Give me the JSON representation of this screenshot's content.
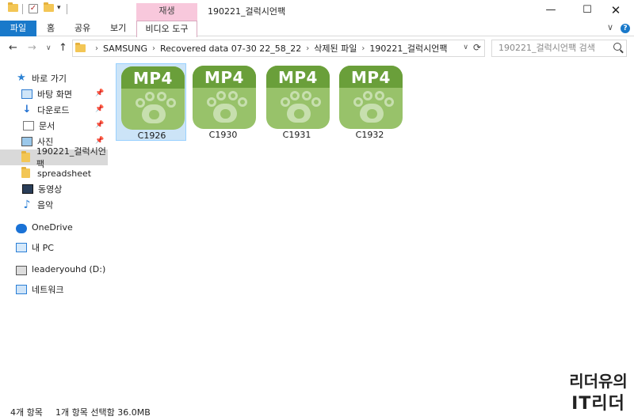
{
  "window": {
    "title": "190221_걸럭시언팩",
    "context_tab_header": "재생",
    "minimize_glyph": "—",
    "maximize_glyph": "☐",
    "close_glyph": "✕"
  },
  "ribbon": {
    "tabs": [
      "파일",
      "홈",
      "공유",
      "보기",
      "비디오 도구"
    ],
    "expand_glyph": "∨",
    "help_glyph": "?"
  },
  "address_bar": {
    "breadcrumbs": [
      "SAMSUNG",
      "Recovered data 07-30 22_58_22",
      "삭제된 파일",
      "190221_걸럭시언팩"
    ],
    "search_placeholder": "190221_걸럭시언팩 검색"
  },
  "sidebar": {
    "quick_access": "바로 가기",
    "items": [
      {
        "label": "바탕 화면",
        "pinned": true,
        "icon": "desktop-icon"
      },
      {
        "label": "다운로드",
        "pinned": true,
        "icon": "download-icon"
      },
      {
        "label": "문서",
        "pinned": true,
        "icon": "document-icon"
      },
      {
        "label": "사진",
        "pinned": true,
        "icon": "pictures-icon"
      },
      {
        "label": "190221_걸럭시언팩",
        "pinned": false,
        "icon": "folder-icon",
        "selected": true
      },
      {
        "label": "spreadsheet",
        "pinned": false,
        "icon": "folder-icon"
      },
      {
        "label": "동영상",
        "pinned": false,
        "icon": "videos-icon"
      },
      {
        "label": "음악",
        "pinned": false,
        "icon": "music-icon"
      }
    ],
    "onedrive": "OneDrive",
    "this_pc": "내 PC",
    "drive": "leaderyouhd (D:)",
    "network": "네트워크"
  },
  "files": [
    {
      "icon_text": "MP4",
      "name": "C1926",
      "selected": true
    },
    {
      "icon_text": "MP4",
      "name": "C1930",
      "selected": false
    },
    {
      "icon_text": "MP4",
      "name": "C1931",
      "selected": false
    },
    {
      "icon_text": "MP4",
      "name": "C1932",
      "selected": false
    }
  ],
  "status": {
    "item_count": "4개 항목",
    "selection": "1개 항목 선택함 36.0MB"
  },
  "watermark": {
    "line1": "리더유의",
    "line2": "IT리더"
  },
  "colors": {
    "file_tab": "#1979ca",
    "context_tab": "#f8c8dc",
    "mp4_band": "#6a9f3a",
    "mp4_body": "#98c26a",
    "selection": "#cce4f7"
  }
}
